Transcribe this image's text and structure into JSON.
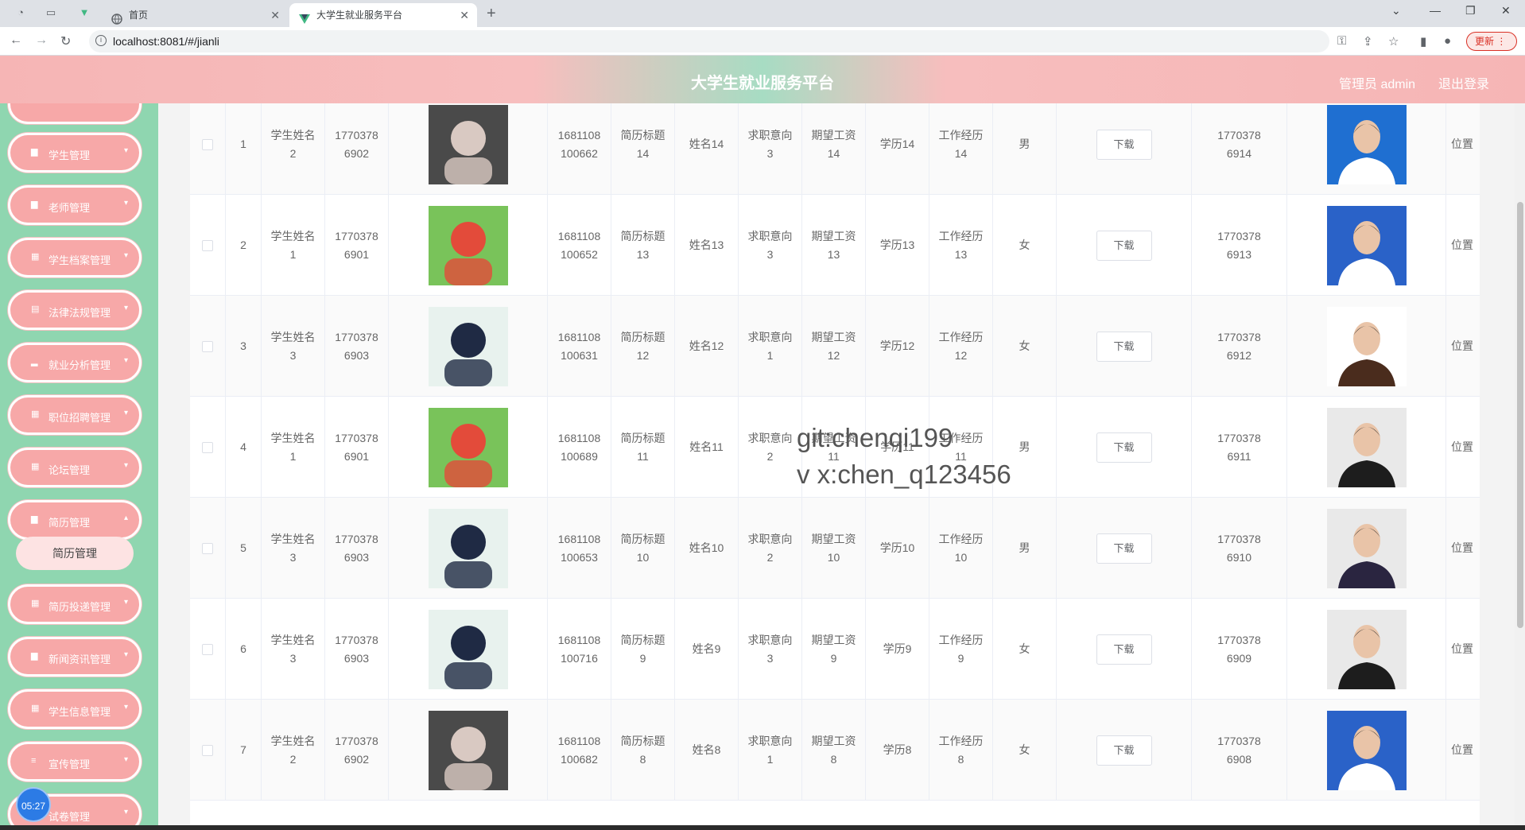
{
  "browser": {
    "tabs": [
      {
        "label": "首页",
        "active": false
      },
      {
        "label": "大学生就业服务平台",
        "active": true
      }
    ],
    "url": "localhost:8081/#/jianli",
    "update_label": "更新"
  },
  "header": {
    "title": "大学生就业服务平台",
    "user": "管理员 admin",
    "logout": "退出登录"
  },
  "sidebar": {
    "items": [
      {
        "label": "学生管理"
      },
      {
        "label": "老师管理"
      },
      {
        "label": "学生档案管理"
      },
      {
        "label": "法律法规管理"
      },
      {
        "label": "就业分析管理"
      },
      {
        "label": "职位招聘管理"
      },
      {
        "label": "论坛管理"
      },
      {
        "label": "简历管理"
      },
      {
        "label": "简历投递管理"
      },
      {
        "label": "新闻资讯管理"
      },
      {
        "label": "学生信息管理"
      },
      {
        "label": "宣传管理"
      },
      {
        "label": "试卷管理"
      }
    ],
    "submenu": {
      "label": "简历管理"
    },
    "timer": "05:27"
  },
  "table": {
    "download_label": "下载",
    "rows": [
      {
        "index": "1",
        "student_name": "学生姓名2",
        "student_phone": "17703786902",
        "resume_no": "1681108100662",
        "resume_title": "简历标题14",
        "name": "姓名14",
        "intention": "求职意向3",
        "salary": "期望工资14",
        "education": "学历14",
        "experience": "工作经历14",
        "gender": "男",
        "phone": "17703786914",
        "location": "位置"
      },
      {
        "index": "2",
        "student_name": "学生姓名1",
        "student_phone": "17703786901",
        "resume_no": "1681108100652",
        "resume_title": "简历标题13",
        "name": "姓名13",
        "intention": "求职意向3",
        "salary": "期望工资13",
        "education": "学历13",
        "experience": "工作经历13",
        "gender": "女",
        "phone": "17703786913",
        "location": "位置"
      },
      {
        "index": "3",
        "student_name": "学生姓名3",
        "student_phone": "17703786903",
        "resume_no": "1681108100631",
        "resume_title": "简历标题12",
        "name": "姓名12",
        "intention": "求职意向1",
        "salary": "期望工资12",
        "education": "学历12",
        "experience": "工作经历12",
        "gender": "女",
        "phone": "17703786912",
        "location": "位置"
      },
      {
        "index": "4",
        "student_name": "学生姓名1",
        "student_phone": "17703786901",
        "resume_no": "1681108100689",
        "resume_title": "简历标题11",
        "name": "姓名11",
        "intention": "求职意向2",
        "salary": "期望工资11",
        "education": "学历11",
        "experience": "工作经历11",
        "gender": "男",
        "phone": "17703786911",
        "location": "位置"
      },
      {
        "index": "5",
        "student_name": "学生姓名3",
        "student_phone": "17703786903",
        "resume_no": "1681108100653",
        "resume_title": "简历标题10",
        "name": "姓名10",
        "intention": "求职意向2",
        "salary": "期望工资10",
        "education": "学历10",
        "experience": "工作经历10",
        "gender": "男",
        "phone": "17703786910",
        "location": "位置"
      },
      {
        "index": "6",
        "student_name": "学生姓名3",
        "student_phone": "17703786903",
        "resume_no": "1681108100716",
        "resume_title": "简历标题9",
        "name": "姓名9",
        "intention": "求职意向3",
        "salary": "期望工资9",
        "education": "学历9",
        "experience": "工作经历9",
        "gender": "女",
        "phone": "17703786909",
        "location": "位置"
      },
      {
        "index": "7",
        "student_name": "学生姓名2",
        "student_phone": "17703786902",
        "resume_no": "1681108100682",
        "resume_title": "简历标题8",
        "name": "姓名8",
        "intention": "求职意向1",
        "salary": "期望工资8",
        "education": "学历8",
        "experience": "工作经历8",
        "gender": "女",
        "phone": "17703786908",
        "location": "位置"
      }
    ]
  },
  "watermark": {
    "line1": "git:chenqi199",
    "line2": "v x:chen_q123456"
  }
}
